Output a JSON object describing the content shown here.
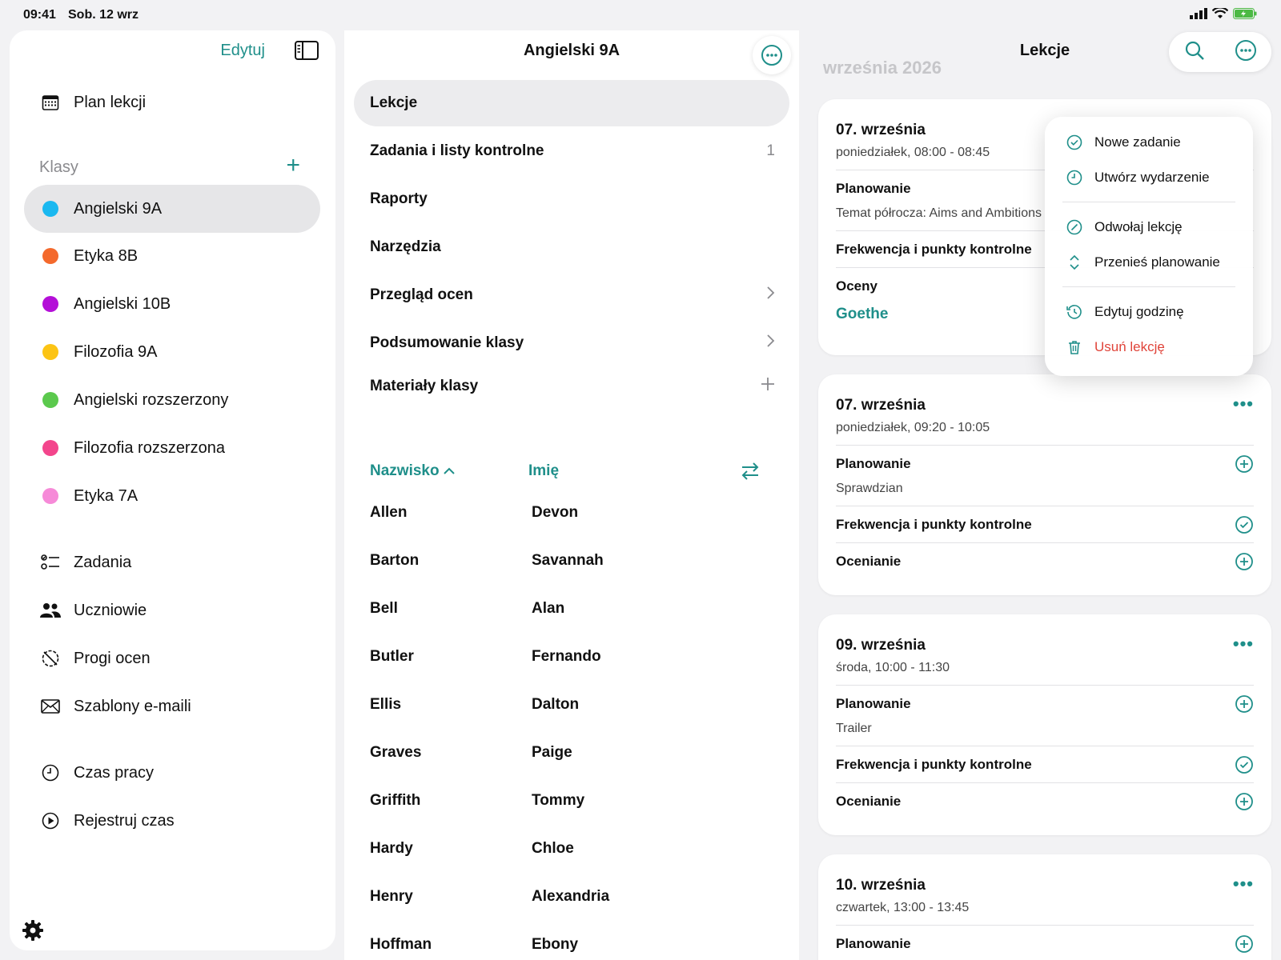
{
  "status": {
    "time": "09:41",
    "date": "Sob. 12 wrz"
  },
  "sidebar": {
    "edit_label": "Edytuj",
    "schedule_label": "Plan lekcji",
    "classes_header": "Klasy",
    "classes": [
      {
        "label": "Angielski 9A",
        "color": "#1ab8f0",
        "selected": true
      },
      {
        "label": "Etyka 8B",
        "color": "#f4692c"
      },
      {
        "label": "Angielski 10B",
        "color": "#b40fd8"
      },
      {
        "label": "Filozofia 9A",
        "color": "#fcc414"
      },
      {
        "label": "Angielski rozszerzony",
        "color": "#5bc94d"
      },
      {
        "label": "Filozofia rozszerzona",
        "color": "#f3458c"
      },
      {
        "label": "Etyka 7A",
        "color": "#f68ad8"
      }
    ],
    "tools": [
      {
        "label": "Zadania",
        "icon": "tasks-icon"
      },
      {
        "label": "Uczniowie",
        "icon": "students-icon"
      },
      {
        "label": "Progi ocen",
        "icon": "grade-thresholds-icon"
      },
      {
        "label": "Szablony e-maili",
        "icon": "envelope-icon"
      }
    ],
    "time_items": [
      {
        "label": "Czas pracy",
        "icon": "clock-icon"
      },
      {
        "label": "Rejestruj czas",
        "icon": "play-icon"
      }
    ]
  },
  "middle": {
    "title": "Angielski 9A",
    "rows": [
      {
        "label": "Lekcje",
        "selected": true,
        "trail": ""
      },
      {
        "label": "Zadania i listy kontrolne",
        "trail": "1"
      },
      {
        "label": "Raporty",
        "trail": ""
      },
      {
        "label": "Narzędzia",
        "trail": ""
      },
      {
        "label": "Przegląd ocen",
        "trail": "chevron"
      },
      {
        "label": "Podsumowanie klasy",
        "trail": "chevron"
      },
      {
        "label": "Materiały klasy",
        "trail": "plus"
      }
    ],
    "sort": {
      "surname": "Nazwisko",
      "first": "Imię"
    },
    "students": [
      {
        "last": "Allen",
        "first": "Devon"
      },
      {
        "last": "Barton",
        "first": "Savannah"
      },
      {
        "last": "Bell",
        "first": "Alan"
      },
      {
        "last": "Butler",
        "first": "Fernando"
      },
      {
        "last": "Ellis",
        "first": "Dalton"
      },
      {
        "last": "Graves",
        "first": "Paige"
      },
      {
        "last": "Griffith",
        "first": "Tommy"
      },
      {
        "last": "Hardy",
        "first": "Chloe"
      },
      {
        "last": "Henry",
        "first": "Alexandria"
      },
      {
        "last": "Hoffman",
        "first": "Ebony"
      }
    ]
  },
  "right": {
    "title": "Lekcje",
    "ghost_heading": "września 2026",
    "cards": [
      {
        "date": "07. września",
        "time": "poniedziałek, 08:00 - 08:45",
        "planning": "Planowanie",
        "planning_note": "Temat półrocza: Aims and Ambitions",
        "attendance": "Frekwencja i punkty kontrolne",
        "grades": "Oceny",
        "grades_link": "Goethe"
      },
      {
        "date": "07. września",
        "time": "poniedziałek, 09:20 - 10:05",
        "planning": "Planowanie",
        "planning_note": "Sprawdzian",
        "attendance": "Frekwencja i punkty kontrolne",
        "grades": "Ocenianie"
      },
      {
        "date": "09. września",
        "time": "środa, 10:00 - 11:30",
        "planning": "Planowanie",
        "planning_note": "Trailer",
        "attendance": "Frekwencja i punkty kontrolne",
        "grades": "Ocenianie"
      },
      {
        "date": "10. września",
        "time": "czwartek, 13:00 - 13:45",
        "planning": "Planowanie"
      }
    ],
    "more_glyph": "•••"
  },
  "menu": {
    "items": [
      {
        "label": "Nowe zadanie",
        "icon": "check-circle-icon"
      },
      {
        "label": "Utwórz wydarzenie",
        "icon": "clock-icon"
      },
      {
        "label": "Odwołaj lekcję",
        "icon": "cancel-circle-icon"
      },
      {
        "label": "Przenieś planowanie",
        "icon": "move-updown-icon"
      },
      {
        "label": "Edytuj godzinę",
        "icon": "history-icon"
      },
      {
        "label": "Usuń lekcję",
        "icon": "trash-icon",
        "danger": true
      }
    ]
  },
  "colors": {
    "accent": "#1f8f8a",
    "danger": "#e0443a"
  }
}
